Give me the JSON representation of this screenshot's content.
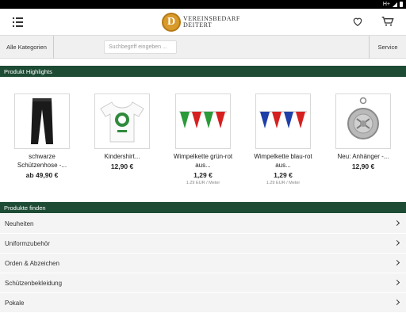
{
  "header": {
    "logo_line1": "VEREINSBEDARF",
    "logo_line2": "DEITERT",
    "logo_letter": "D"
  },
  "navbar": {
    "categories_label": "Alle Kategorien",
    "search_placeholder": "Suchbegriff eingeben ...",
    "service_label": "Service"
  },
  "highlights": {
    "title": "Produkt Highlights",
    "products": [
      {
        "name1": "schwarze",
        "name2": "Schützenhose -...",
        "price": "ab 49,90 €",
        "unit": ""
      },
      {
        "name1": "Kindershirt...",
        "name2": "",
        "price": "12,90 €",
        "unit": ""
      },
      {
        "name1": "Wimpelkette grün-rot",
        "name2": "aus...",
        "price": "1,29 €",
        "unit": "1.29 EUR / Meter"
      },
      {
        "name1": "Wimpelkette blau-rot",
        "name2": "aus...",
        "price": "1,29 €",
        "unit": "1.29 EUR / Meter"
      },
      {
        "name1": "Neu: Anhänger -...",
        "name2": "",
        "price": "12,90 €",
        "unit": ""
      }
    ]
  },
  "finder": {
    "title": "Produkte finden",
    "items": [
      "Neuheiten",
      "Uniformzubehör",
      "Orden & Abzeichen",
      "Schützenbekleidung",
      "Pokale"
    ]
  },
  "colors": {
    "brand_green": "#1d4b34",
    "logo_gold": "#d89a2a"
  }
}
